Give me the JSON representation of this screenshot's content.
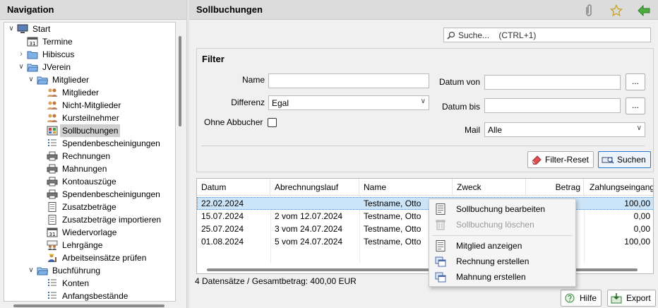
{
  "navigation": {
    "title": "Navigation",
    "items": [
      {
        "label": "Start",
        "icon": "monitor-icon",
        "level": 0,
        "twisty": "open"
      },
      {
        "label": "Termine",
        "icon": "calendar-icon",
        "level": 1,
        "twisty": "none"
      },
      {
        "label": "Hibiscus",
        "icon": "folder-icon",
        "level": 1,
        "twisty": "closed"
      },
      {
        "label": "JVerein",
        "icon": "folder-open-icon",
        "level": 1,
        "twisty": "open"
      },
      {
        "label": "Mitglieder",
        "icon": "folder-open-icon",
        "level": 2,
        "twisty": "open"
      },
      {
        "label": "Mitglieder",
        "icon": "people-icon",
        "level": 3,
        "twisty": "none"
      },
      {
        "label": "Nicht-Mitglieder",
        "icon": "people-icon",
        "level": 3,
        "twisty": "none"
      },
      {
        "label": "Kursteilnehmer",
        "icon": "people-icon",
        "level": 3,
        "twisty": "none"
      },
      {
        "label": "Sollbuchungen",
        "icon": "ledger-icon",
        "level": 3,
        "twisty": "none",
        "selected": true
      },
      {
        "label": "Spendenbescheinigungen",
        "icon": "list-icon",
        "level": 3,
        "twisty": "none"
      },
      {
        "label": "Rechnungen",
        "icon": "printer-icon",
        "level": 3,
        "twisty": "none"
      },
      {
        "label": "Mahnungen",
        "icon": "printer-icon",
        "level": 3,
        "twisty": "none"
      },
      {
        "label": "Kontoauszüge",
        "icon": "printer-icon",
        "level": 3,
        "twisty": "none"
      },
      {
        "label": "Spendenbescheinigungen",
        "icon": "printer-icon",
        "level": 3,
        "twisty": "none"
      },
      {
        "label": "Zusatzbeträge",
        "icon": "document-icon",
        "level": 3,
        "twisty": "none"
      },
      {
        "label": "Zusatzbeträge importieren",
        "icon": "document-icon",
        "level": 3,
        "twisty": "none"
      },
      {
        "label": "Wiedervorlage",
        "icon": "calendar-icon",
        "level": 3,
        "twisty": "none"
      },
      {
        "label": "Lehrgänge",
        "icon": "people-icon",
        "level": 3,
        "twisty": "none"
      },
      {
        "label": "Arbeitseinsätze prüfen",
        "icon": "worker-icon",
        "level": 3,
        "twisty": "none"
      },
      {
        "label": "Buchführung",
        "icon": "folder-open-icon",
        "level": 2,
        "twisty": "open"
      },
      {
        "label": "Konten",
        "icon": "list-icon",
        "level": 3,
        "twisty": "none"
      },
      {
        "label": "Anfangsbestände",
        "icon": "list-icon",
        "level": 3,
        "twisty": "none"
      }
    ]
  },
  "main": {
    "title": "Sollbuchungen",
    "search": {
      "placeholder": "Suche...    (CTRL+1)"
    }
  },
  "filter": {
    "title": "Filter",
    "name_label": "Name",
    "name_value": "",
    "differenz_label": "Differenz",
    "differenz_value": "Egal",
    "ohne_abbucher_label": "Ohne Abbucher",
    "datum_von_label": "Datum von",
    "datum_bis_label": "Datum bis",
    "date_button": "...",
    "mail_label": "Mail",
    "mail_value": "Alle",
    "reset_label": "Filter-Reset",
    "search_label": "Suchen"
  },
  "table": {
    "columns": [
      "Datum",
      "Abrechnungslauf",
      "Name",
      "Zweck",
      "Betrag",
      "Zahlungseingang"
    ],
    "rows": [
      {
        "datum": "22.02.2024",
        "lauf": "",
        "name": "Testname, Otto",
        "zweck": "",
        "betrag": "",
        "eingang": "100,00",
        "selected": true
      },
      {
        "datum": "15.07.2024",
        "lauf": "2 vom 12.07.2024",
        "name": "Testname, Otto",
        "zweck": "",
        "betrag": "",
        "eingang": "0,00"
      },
      {
        "datum": "25.07.2024",
        "lauf": "3 vom 24.07.2024",
        "name": "Testname, Otto",
        "zweck": "",
        "betrag": "",
        "eingang": "0,00"
      },
      {
        "datum": "01.08.2024",
        "lauf": "5 vom 24.07.2024",
        "name": "Testname, Otto",
        "zweck": "",
        "betrag": "",
        "eingang": "100,00"
      }
    ]
  },
  "status": "4 Datensätze / Gesamtbetrag: 400,00 EUR",
  "footer": {
    "help_label": "Hilfe",
    "export_label": "Export"
  },
  "context_menu": {
    "items": [
      {
        "label": "Sollbuchung bearbeiten",
        "icon": "document-icon",
        "disabled": false
      },
      {
        "label": "Sollbuchung löschen",
        "icon": "trash-icon",
        "disabled": true
      },
      {
        "label": "Mitglied anzeigen",
        "icon": "document-icon",
        "disabled": false
      },
      {
        "label": "Rechnung erstellen",
        "icon": "window-icon",
        "disabled": false
      },
      {
        "label": "Mahnung erstellen",
        "icon": "window-icon",
        "disabled": false
      }
    ]
  }
}
